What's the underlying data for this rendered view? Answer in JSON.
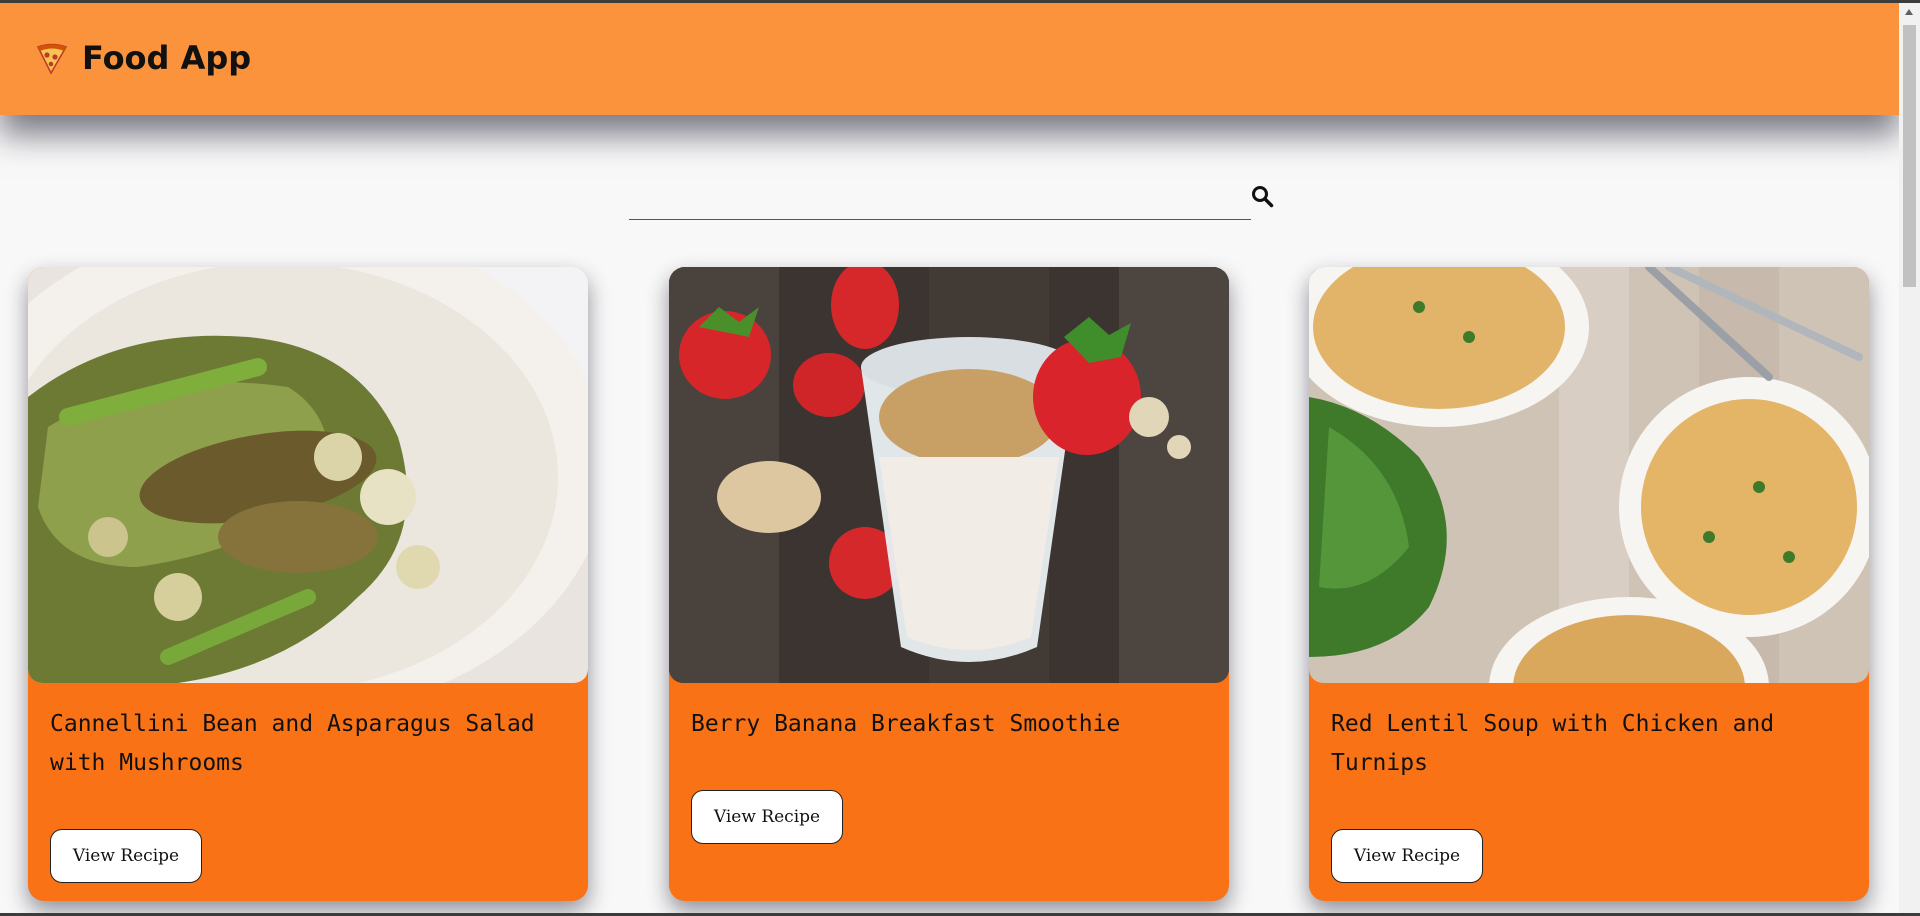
{
  "app": {
    "title": "Food App",
    "brand_color": "#fb923c",
    "icon": "pizza-icon"
  },
  "search": {
    "placeholder": "",
    "value": "",
    "icon": "search-icon"
  },
  "cards": [
    {
      "title": "Cannellini Bean and Asparagus Salad with Mushrooms",
      "button_label": "View Recipe",
      "image": "salad-photo"
    },
    {
      "title": "Berry Banana Breakfast Smoothie",
      "button_label": "View Recipe",
      "image": "smoothie-photo"
    },
    {
      "title": "Red Lentil Soup with Chicken and Turnips",
      "button_label": "View Recipe",
      "image": "soup-photo"
    }
  ],
  "colors": {
    "card_bg": "#f97316",
    "page_bg": "#f8f8f8"
  }
}
